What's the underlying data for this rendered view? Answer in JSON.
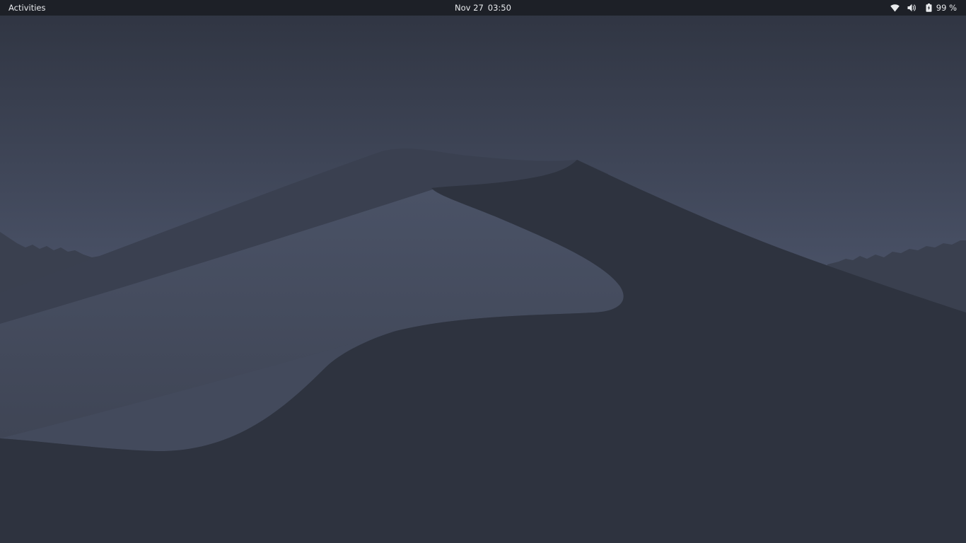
{
  "topbar": {
    "activities_label": "Activities",
    "clock": {
      "date": "Nov 27",
      "time": "03:50"
    },
    "tray": {
      "network_icon": "wifi-icon",
      "volume_icon": "volume-icon",
      "battery_icon": "battery-icon",
      "battery_percent": "99 %"
    }
  },
  "wallpaper": {
    "theme": "dark desert dunes",
    "colors": {
      "sky_top": "#2f3441",
      "sky_bottom": "#4a5266",
      "dune_shadow": "#2e333f",
      "dune_light": "#444b5d",
      "dune_mid": "#3a4050"
    }
  }
}
